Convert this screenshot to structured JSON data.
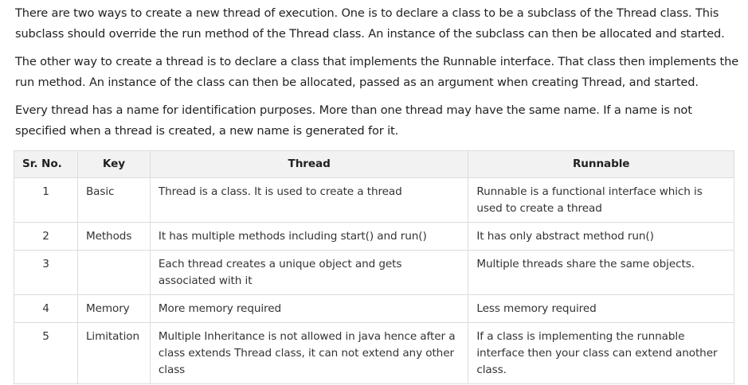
{
  "paragraphs": [
    "There are two ways to create a new thread of execution. One is to declare a class to be a subclass of the Thread class. This subclass should override the run method of the Thread class. An instance of the subclass can then be allocated and started.",
    "The other way to create a thread is to declare a class that implements the Runnable interface. That class then implements the run method. An instance of the class can then be allocated, passed as an argument when creating Thread, and started.",
    "Every thread has a name for identification purposes. More than one thread may have the same name. If a name is not specified when a thread is created, a new name is generated for it."
  ],
  "table": {
    "headers": [
      "Sr. No.",
      "Key",
      "Thread",
      "Runnable"
    ],
    "rows": [
      [
        "1",
        "Basic",
        "Thread is a class. It is used to create a thread",
        "Runnable is a functional interface which is used to create a thread"
      ],
      [
        "2",
        "Methods",
        "It has multiple methods including start() and run()",
        "It has only abstract method run()"
      ],
      [
        "3",
        "",
        "Each thread creates a unique object and gets associated with it",
        "Multiple threads share the same objects."
      ],
      [
        "4",
        "Memory",
        "More memory required",
        "Less memory required"
      ],
      [
        "5",
        "Limitation",
        "Multiple Inheritance is not allowed in java hence after a class extends Thread class, it can not extend any other class",
        "If a class is implementing the runnable interface then your class can extend another class."
      ]
    ]
  }
}
